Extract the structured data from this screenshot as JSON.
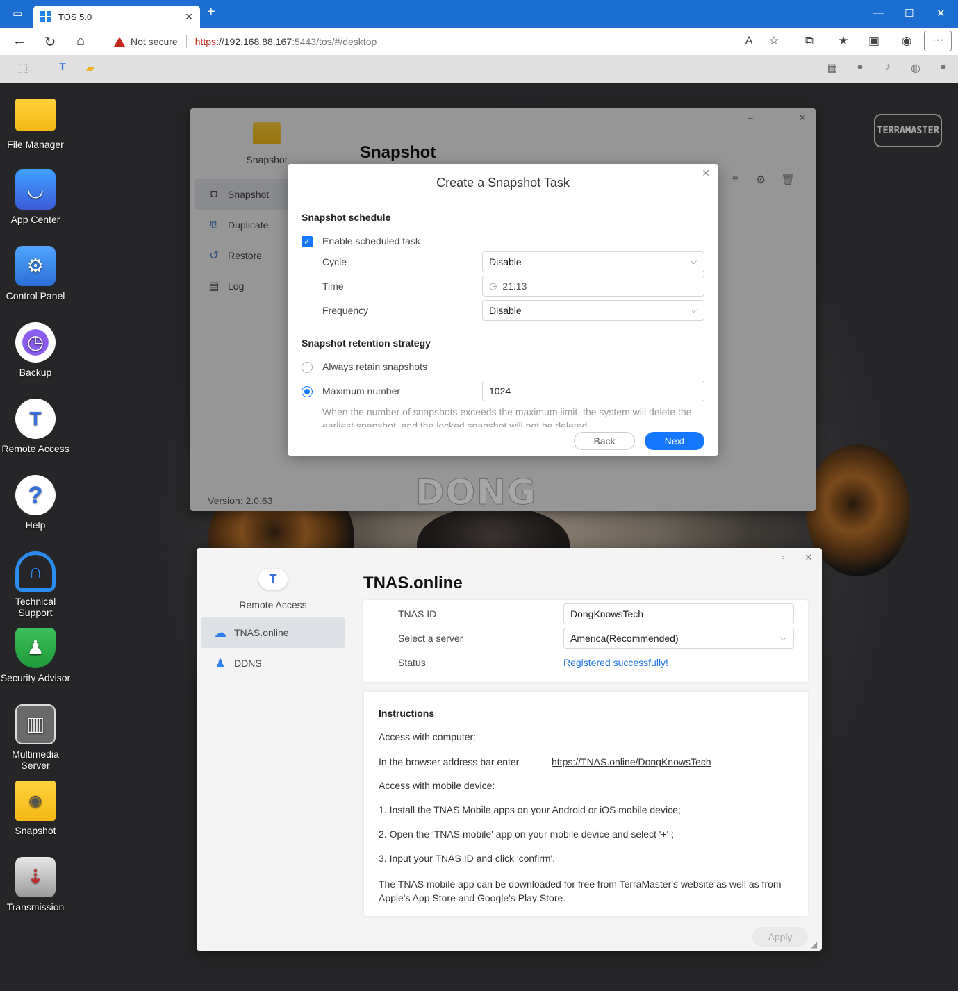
{
  "browser": {
    "tab_title": "TOS 5.0",
    "security_label": "Not secure",
    "url_scheme": "https",
    "url_host": "://192.168.88.167",
    "url_path": ":5443/tos/#/desktop"
  },
  "desktop": {
    "brand": "TERRAMASTER",
    "icons": [
      {
        "label": "File Manager"
      },
      {
        "label": "App Center"
      },
      {
        "label": "Control Panel"
      },
      {
        "label": "Backup"
      },
      {
        "label": "Remote Access"
      },
      {
        "label": "Help"
      },
      {
        "label": "Technical Support"
      },
      {
        "label": "Security Advisor"
      },
      {
        "label": "Multimedia Server"
      },
      {
        "label": "Snapshot"
      },
      {
        "label": "Transmission"
      }
    ],
    "watermark": "DONG"
  },
  "snapshot_window": {
    "app_name": "Snapshot",
    "title": "Snapshot",
    "nav": [
      {
        "label": "Snapshot"
      },
      {
        "label": "Duplicate"
      },
      {
        "label": "Restore"
      },
      {
        "label": "Log"
      }
    ],
    "version": "Version: 2.0.63"
  },
  "dialog": {
    "title": "Create a Snapshot Task",
    "schedule_heading": "Snapshot schedule",
    "enable_label": "Enable scheduled task",
    "cycle_label": "Cycle",
    "cycle_value": "Disable",
    "time_label": "Time",
    "time_value": "21:13",
    "frequency_label": "Frequency",
    "frequency_value": "Disable",
    "retention_heading": "Snapshot retention strategy",
    "always_label": "Always retain snapshots",
    "max_label": "Maximum number",
    "max_value": "1024",
    "hint": "When the number of snapshots exceeds the maximum limit, the system will delete the earliest snapshot, and the locked snapshot will not be deleted.",
    "back_label": "Back",
    "next_label": "Next"
  },
  "tnas_window": {
    "app_name": "Remote Access",
    "title": "TNAS.online",
    "nav": [
      {
        "label": "TNAS.online"
      },
      {
        "label": "DDNS"
      }
    ],
    "tnas_id_label": "TNAS ID",
    "tnas_id_value": "DongKnowsTech",
    "server_label": "Select a server",
    "server_value": "America(Recommended)",
    "status_label": "Status",
    "status_value": "Registered successfully!",
    "instructions": {
      "heading": "Instructions",
      "computer": "Access with computer:",
      "browser_line": "In the browser address bar enter",
      "link": "https://TNAS.online/DongKnowsTech",
      "mobile": "Access with mobile device:",
      "step1": "1. Install the TNAS Mobile apps on your Android or iOS mobile device;",
      "step2": "2. Open the 'TNAS mobile' app on your mobile device and select '+' ;",
      "step3": "3. Input your TNAS ID and click 'confirm'.",
      "note": "The TNAS mobile app can be downloaded for free from TerraMaster's website as well as from Apple's App Store and Google's Play Store."
    },
    "apply_label": "Apply"
  }
}
